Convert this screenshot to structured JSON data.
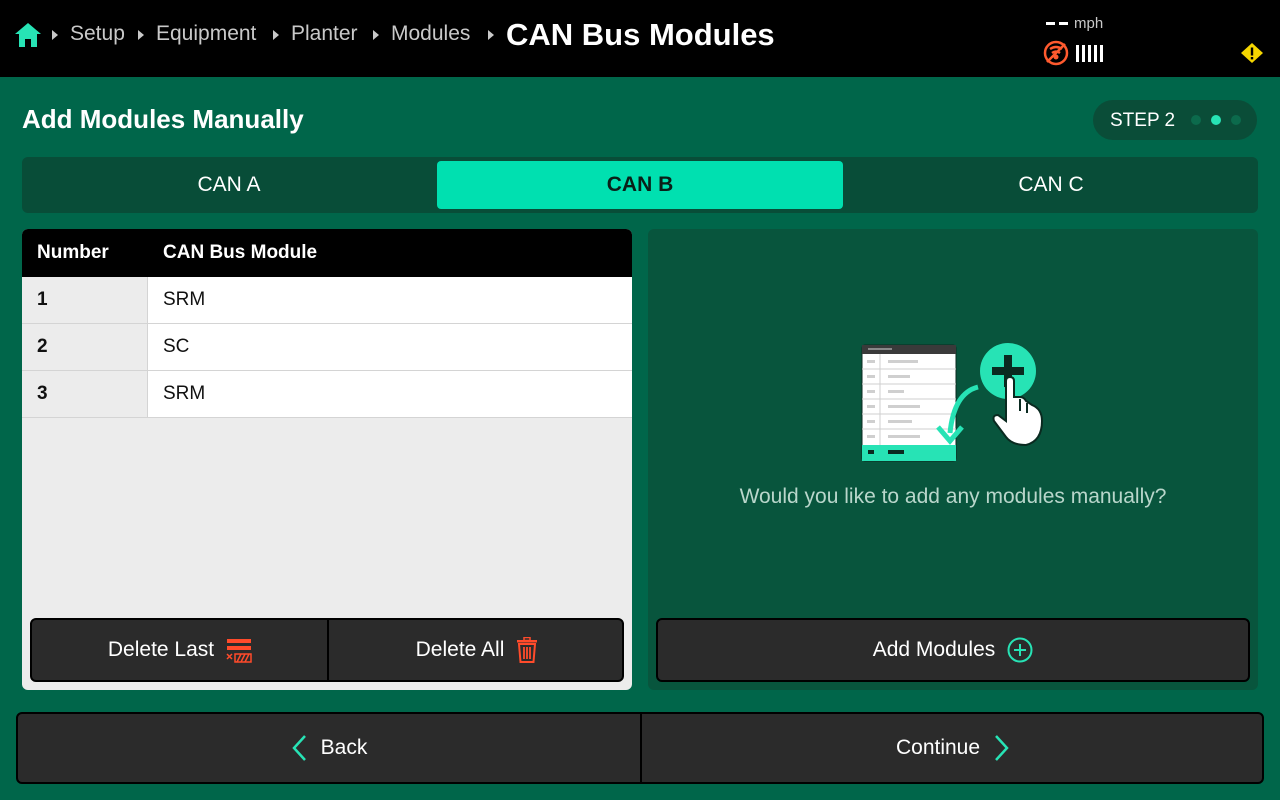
{
  "topbar": {
    "home_icon": "home-icon",
    "breadcrumb": [
      "Setup",
      "Equipment",
      "Planter",
      "Modules"
    ],
    "title": "CAN Bus Modules",
    "speed_unit": "mph",
    "status_icons": [
      "gps-signal-lost-icon",
      "signal-strength-icon",
      "warning-icon"
    ],
    "accent_color": "#27e3b5",
    "gps_color": "#ff5a2e",
    "warning_color": "#f5d600"
  },
  "header": {
    "title": "Add Modules Manually",
    "step_label": "STEP 2",
    "step_total": 3,
    "step_current": 2
  },
  "tabs": [
    {
      "label": "CAN A",
      "active": false
    },
    {
      "label": "CAN B",
      "active": true
    },
    {
      "label": "CAN C",
      "active": false
    }
  ],
  "table": {
    "columns": [
      "Number",
      "CAN Bus Module"
    ],
    "rows": [
      {
        "number": "1",
        "module": "SRM"
      },
      {
        "number": "2",
        "module": "SC"
      },
      {
        "number": "3",
        "module": "SRM"
      }
    ]
  },
  "left_actions": {
    "delete_last_label": "Delete Last",
    "delete_last_icon": "delete-last-icon",
    "delete_all_label": "Delete All",
    "delete_all_icon": "trash-icon",
    "danger_color": "#ff4b2b"
  },
  "right_panel": {
    "illustration": "add-module-illustration",
    "prompt": "Would you like to add any modules manually?",
    "add_label": "Add Modules",
    "add_icon": "plus-circle-icon"
  },
  "bottom_nav": {
    "back_label": "Back",
    "back_icon": "chevron-left-icon",
    "continue_label": "Continue",
    "continue_icon": "chevron-right-icon"
  }
}
